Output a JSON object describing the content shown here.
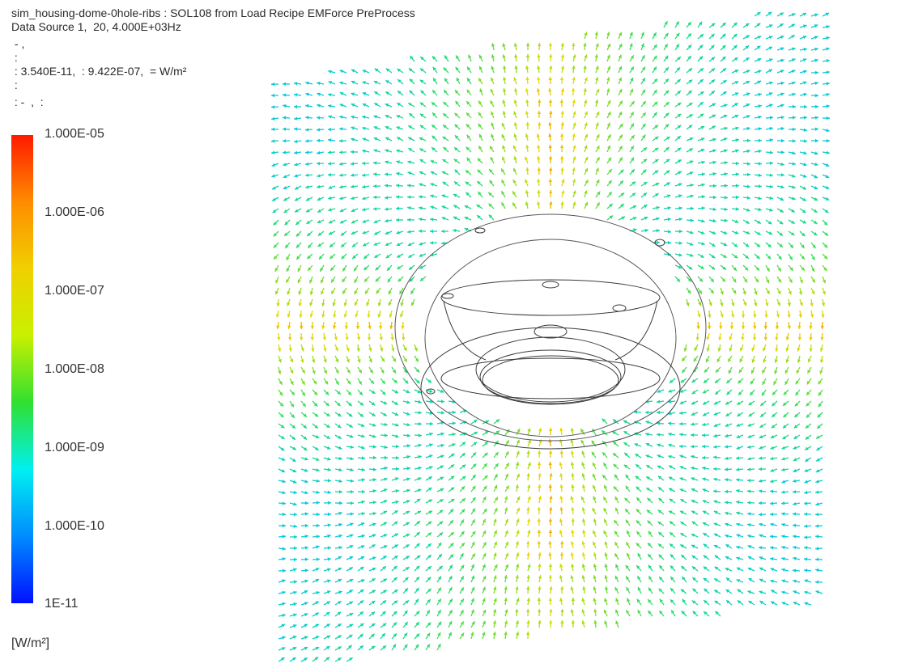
{
  "header": {
    "title": "sim_housing-dome-0hole-ribs : SOL108 from Load Recipe EMForce PreProcess",
    "source": "Data Source 1,  20, 4.000E+03Hz",
    "line3": " - ,",
    "line4": " :",
    "line5": " : 3.540E-11,  : 9.422E-07,  = W/m²",
    "line6": " :",
    "line7": " : -  ,  :"
  },
  "legend": {
    "ticks": [
      "1.000E-05",
      "1.000E-06",
      "1.000E-07",
      "1.000E-08",
      "1.000E-09",
      "1.000E-10",
      "1E-11"
    ],
    "units": "[W/m²]",
    "colors": [
      "#ff1a00",
      "#ff8c00",
      "#f0d000",
      "#c8f000",
      "#30e030",
      "#00f0f0",
      "#008cff",
      "#0010ff"
    ]
  },
  "model": {
    "type": "vector-field",
    "color_scale": "log",
    "min": 3.54e-11,
    "max": 9.422e-07
  }
}
